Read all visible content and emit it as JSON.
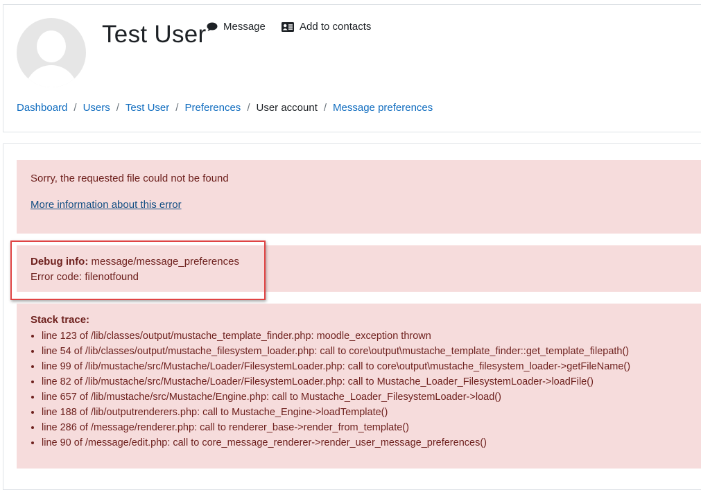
{
  "user": {
    "name": "Test User"
  },
  "header_actions": {
    "message": {
      "label": "Message",
      "icon": "speech-bubble-icon"
    },
    "add_contact": {
      "label": "Add to contacts",
      "icon": "address-card-icon"
    }
  },
  "breadcrumb": [
    {
      "label": "Dashboard",
      "link": true
    },
    {
      "label": "Users",
      "link": true
    },
    {
      "label": "Test User",
      "link": true
    },
    {
      "label": "Preferences",
      "link": true
    },
    {
      "label": "User account",
      "link": false
    },
    {
      "label": "Message preferences",
      "link": true
    }
  ],
  "error": {
    "message": "Sorry, the requested file could not be found",
    "more_info_link": "More information about this error"
  },
  "debug": {
    "label": "Debug info:",
    "value": "message/message_preferences",
    "code_label": "Error code: ",
    "code_value": "filenotfound"
  },
  "stack_trace": {
    "title": "Stack trace:",
    "lines": [
      "line 123 of /lib/classes/output/mustache_template_finder.php: moodle_exception thrown",
      "line 54 of /lib/classes/output/mustache_filesystem_loader.php: call to core\\output\\mustache_template_finder::get_template_filepath()",
      "line 99 of /lib/mustache/src/Mustache/Loader/FilesystemLoader.php: call to core\\output\\mustache_filesystem_loader->getFileName()",
      "line 82 of /lib/mustache/src/Mustache/Loader/FilesystemLoader.php: call to Mustache_Loader_FilesystemLoader->loadFile()",
      "line 657 of /lib/mustache/src/Mustache/Engine.php: call to Mustache_Loader_FilesystemLoader->load()",
      "line 188 of /lib/outputrenderers.php: call to Mustache_Engine->loadTemplate()",
      "line 286 of /message/renderer.php: call to renderer_base->render_from_template()",
      "line 90 of /message/edit.php: call to core_message_renderer->render_user_message_preferences()"
    ]
  },
  "colors": {
    "link": "#0f6cbf",
    "alert_bg": "#f6dcdc",
    "alert_text": "#6e211e",
    "highlight": "#e04343"
  }
}
